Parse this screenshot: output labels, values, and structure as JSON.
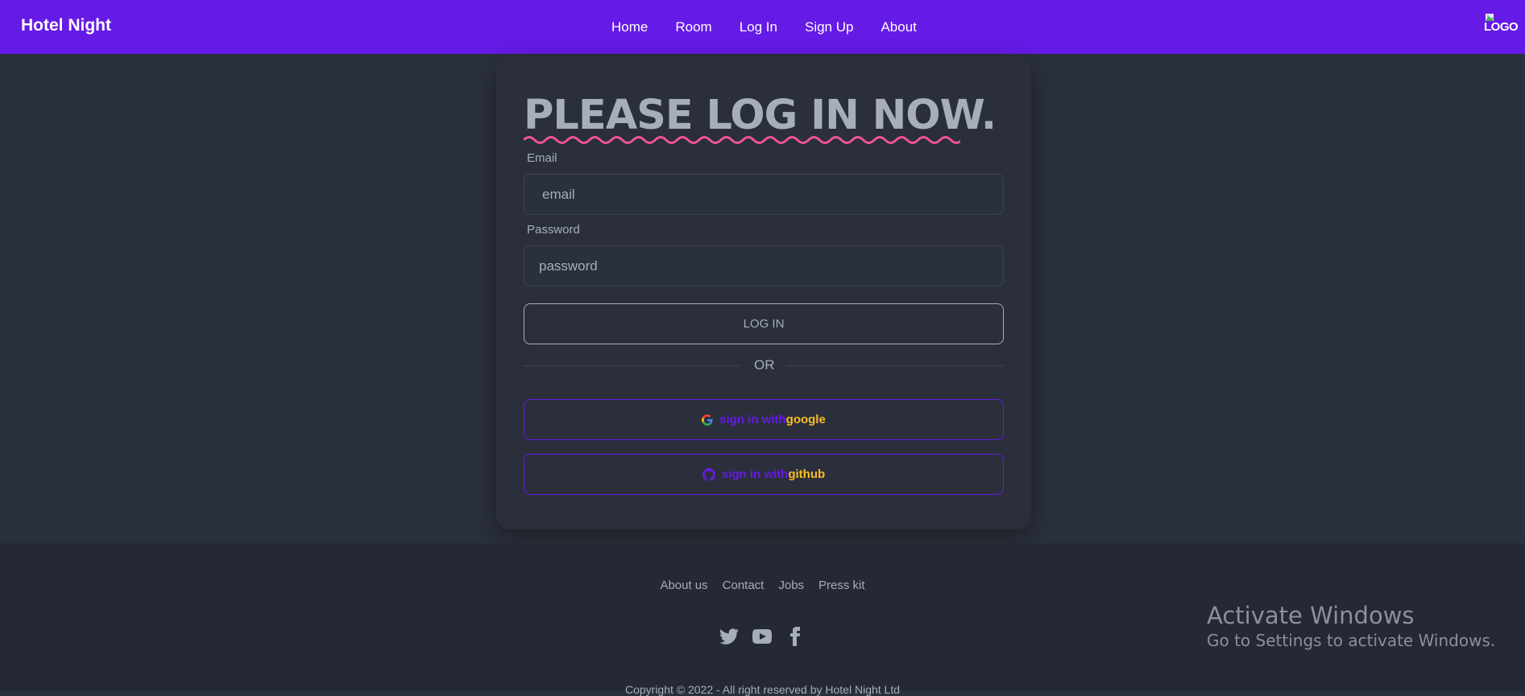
{
  "navbar": {
    "brand": "Hotel Night",
    "items": [
      {
        "label": "Home"
      },
      {
        "label": "Room"
      },
      {
        "label": "Log In"
      },
      {
        "label": "Sign Up"
      },
      {
        "label": "About"
      }
    ],
    "logo_text": "LOGO"
  },
  "login": {
    "title": "PLEASE LOG IN NOW.",
    "email_label": "Email",
    "email_placeholder": "email",
    "password_label": "Password",
    "password_placeholder": "password",
    "login_button": "LOG IN",
    "divider_text": "OR",
    "google": {
      "lead": "sign in with",
      "brand": "google"
    },
    "github": {
      "lead": "sign in with",
      "brand": "github"
    }
  },
  "footer": {
    "links": [
      {
        "label": "About us"
      },
      {
        "label": "Contact"
      },
      {
        "label": "Jobs"
      },
      {
        "label": "Press kit"
      }
    ],
    "social_icons": [
      "twitter-icon",
      "youtube-icon",
      "facebook-icon"
    ],
    "copyright": "Copyright © 2022 - All right reserved by Hotel Night Ltd"
  },
  "watermark": {
    "title": "Activate Windows",
    "subtitle": "Go to Settings to activate Windows."
  },
  "colors": {
    "primary": "#661ae6",
    "accent": "#fbbd23",
    "squiggle": "#f0529c",
    "base_bg": "#2a303c",
    "footer_bg": "#242933",
    "text": "#a6adbb"
  }
}
